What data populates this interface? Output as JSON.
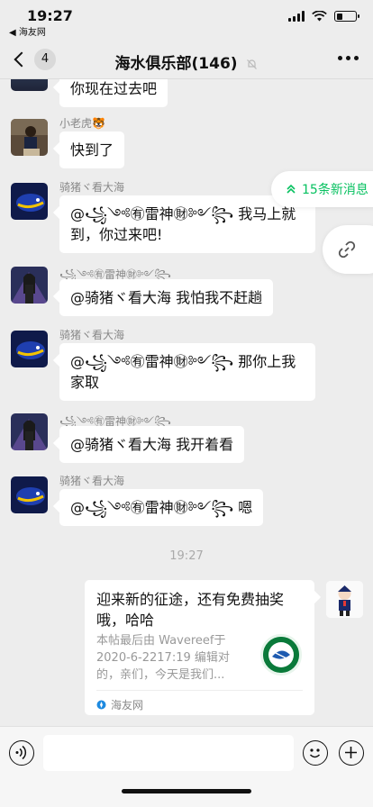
{
  "status_bar": {
    "time": "19:27",
    "back_app": "◀ 海友网",
    "battery_level": 0.3
  },
  "nav": {
    "back_count": "4",
    "title": "海水俱乐部(146)"
  },
  "chat": {
    "messages": [
      {
        "sender": "",
        "text": "你现在过去吧"
      },
      {
        "sender": "小老虎🐯",
        "text": "快到了"
      },
      {
        "sender": "骑猪ヾ看大海",
        "text": "@꧁༺㊒雷神㊖༻꧂ 我马上就到，你过来吧!"
      },
      {
        "sender": "꧁༺㊒雷神㊖༻꧂",
        "text": "@骑猪ヾ看大海 我怕我不赶趟"
      },
      {
        "sender": "骑猪ヾ看大海",
        "text": "@꧁༺㊒雷神㊖༻꧂ 那你上我家取"
      },
      {
        "sender": "꧁༺㊒雷神㊖༻꧂",
        "text": "@骑猪ヾ看大海 我开着看"
      },
      {
        "sender": "骑猪ヾ看大海",
        "text": "@꧁༺㊒雷神㊖༻꧂ 嗯"
      }
    ],
    "time_divider": "19:27",
    "new_messages_label": "15条新消息",
    "shared_card": {
      "title": "迎来新的征途，还有免费抽奖哦，哈哈",
      "description": "本帖最后由 Wavereef于 2020-6-2217:19 编辑对的，亲们，今天是我们...",
      "source": "海友网"
    }
  },
  "input": {
    "placeholder": ""
  },
  "colors": {
    "accent": "#07c160",
    "background": "#ededed",
    "bubble": "#ffffff"
  }
}
